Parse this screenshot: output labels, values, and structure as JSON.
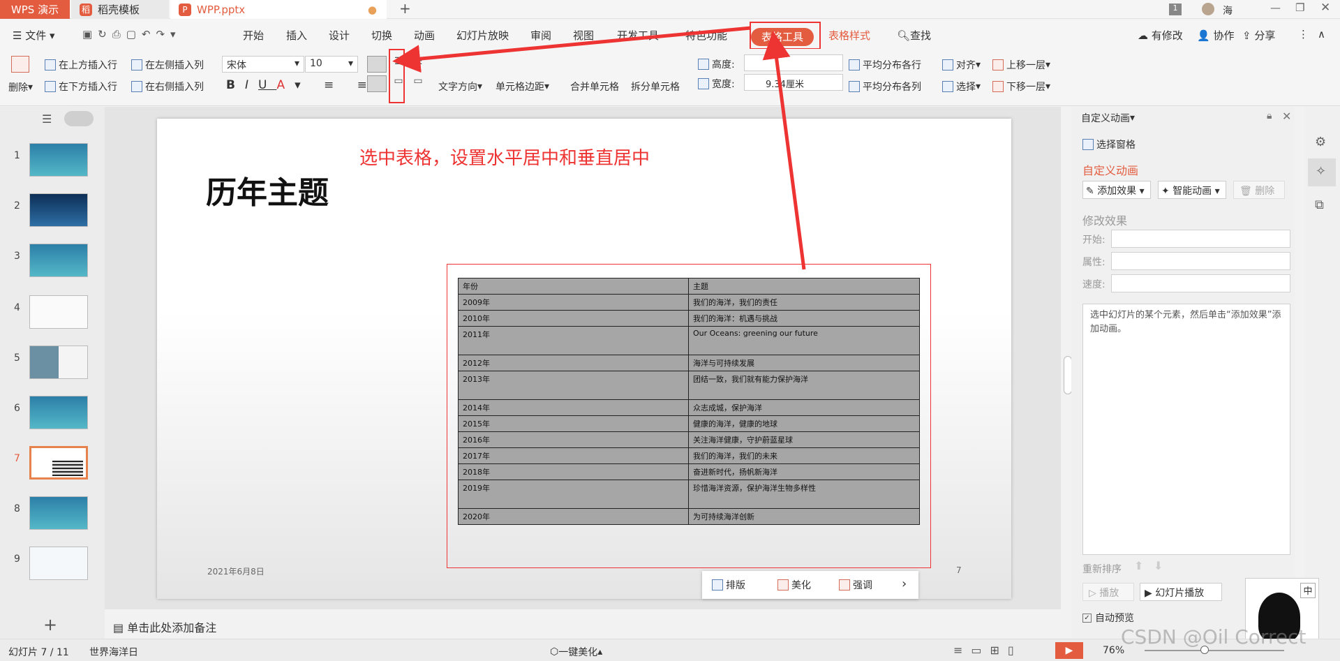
{
  "titlebar": {
    "app_tab": "WPS 演示",
    "tabs": [
      {
        "label": "稻壳模板"
      },
      {
        "label": "WPP.pptx"
      }
    ],
    "new_tab": "+",
    "window_badge": "1",
    "user": "海"
  },
  "menu": {
    "file": "文件",
    "items": [
      "开始",
      "插入",
      "设计",
      "切换",
      "动画",
      "幻灯片放映",
      "审阅",
      "视图",
      "开发工具",
      "特色功能"
    ],
    "table_tools": "表格工具",
    "table_style": "表格样式",
    "search": "查找",
    "modified": "有修改",
    "collab": "协作",
    "share": "分享"
  },
  "ribbon": {
    "delete": "删除",
    "insert_above": "在上方插入行",
    "insert_below": "在下方插入行",
    "insert_left": "在左侧插入列",
    "insert_right": "在右侧插入列",
    "font": "宋体",
    "size": "10",
    "text_dir": "文字方向",
    "cell_margin": "单元格边距",
    "merge": "合并单元格",
    "split": "拆分单元格",
    "height": "高度:",
    "width": "宽度:",
    "width_value": "9.34厘米",
    "dist_rows": "平均分布各行",
    "dist_cols": "平均分布各列",
    "align": "对齐",
    "select": "选择",
    "bring_forward": "上移一层",
    "send_backward": "下移一层"
  },
  "slides": {
    "numbers": [
      "1",
      "2",
      "3",
      "4",
      "5",
      "6",
      "7",
      "8",
      "9"
    ],
    "selected": "7"
  },
  "slide": {
    "title": "历年主题",
    "annotation": "选中表格，设置水平居中和垂直居中",
    "date": "2021年6月8日",
    "page": "7"
  },
  "table": {
    "rows": [
      [
        "年份",
        "主题"
      ],
      [
        "2009年",
        "我们的海洋，我们的责任"
      ],
      [
        "2010年",
        "我们的海洋：机遇与挑战"
      ],
      [
        "2011年",
        "Our Oceans: greening our future"
      ],
      [
        "2012年",
        "海洋与可持续发展"
      ],
      [
        "2013年",
        "团结一致，我们就有能力保护海洋"
      ],
      [
        "2014年",
        "众志成城，保护海洋"
      ],
      [
        "2015年",
        "健康的海洋，健康的地球"
      ],
      [
        "2016年",
        "关注海洋健康，守护蔚蓝星球"
      ],
      [
        "2017年",
        "我们的海洋，我们的未来"
      ],
      [
        "2018年",
        "奋进新时代，扬帆新海洋"
      ],
      [
        "2019年",
        "珍惜海洋资源，保护海洋生物多样性"
      ],
      [
        "2020年",
        "为可持续海洋创新"
      ]
    ]
  },
  "float_toolbar": {
    "layout": "排版",
    "beautify": "美化",
    "emphasis": "强调"
  },
  "notes": {
    "placeholder": "单击此处添加备注"
  },
  "anim_panel": {
    "header": "自定义动画",
    "select_pane": "选择窗格",
    "title": "自定义动画",
    "add_effect": "添加效果",
    "smart_anim": "智能动画",
    "delete": "删除",
    "modify": "修改效果",
    "start": "开始:",
    "property": "属性:",
    "speed": "速度:",
    "hint": "选中幻灯片的某个元素，然后单击“添加效果”添加动画。",
    "reorder": "重新排序",
    "play": "播放",
    "slideshow": "幻灯片播放",
    "autopreview": "自动预览"
  },
  "status": {
    "slide_pos": "幻灯片 7 / 11",
    "theme": "世界海洋日",
    "beautify": "一键美化",
    "zoom": "76%"
  },
  "watermark": "CSDN @Oil Correct",
  "ime": "中"
}
